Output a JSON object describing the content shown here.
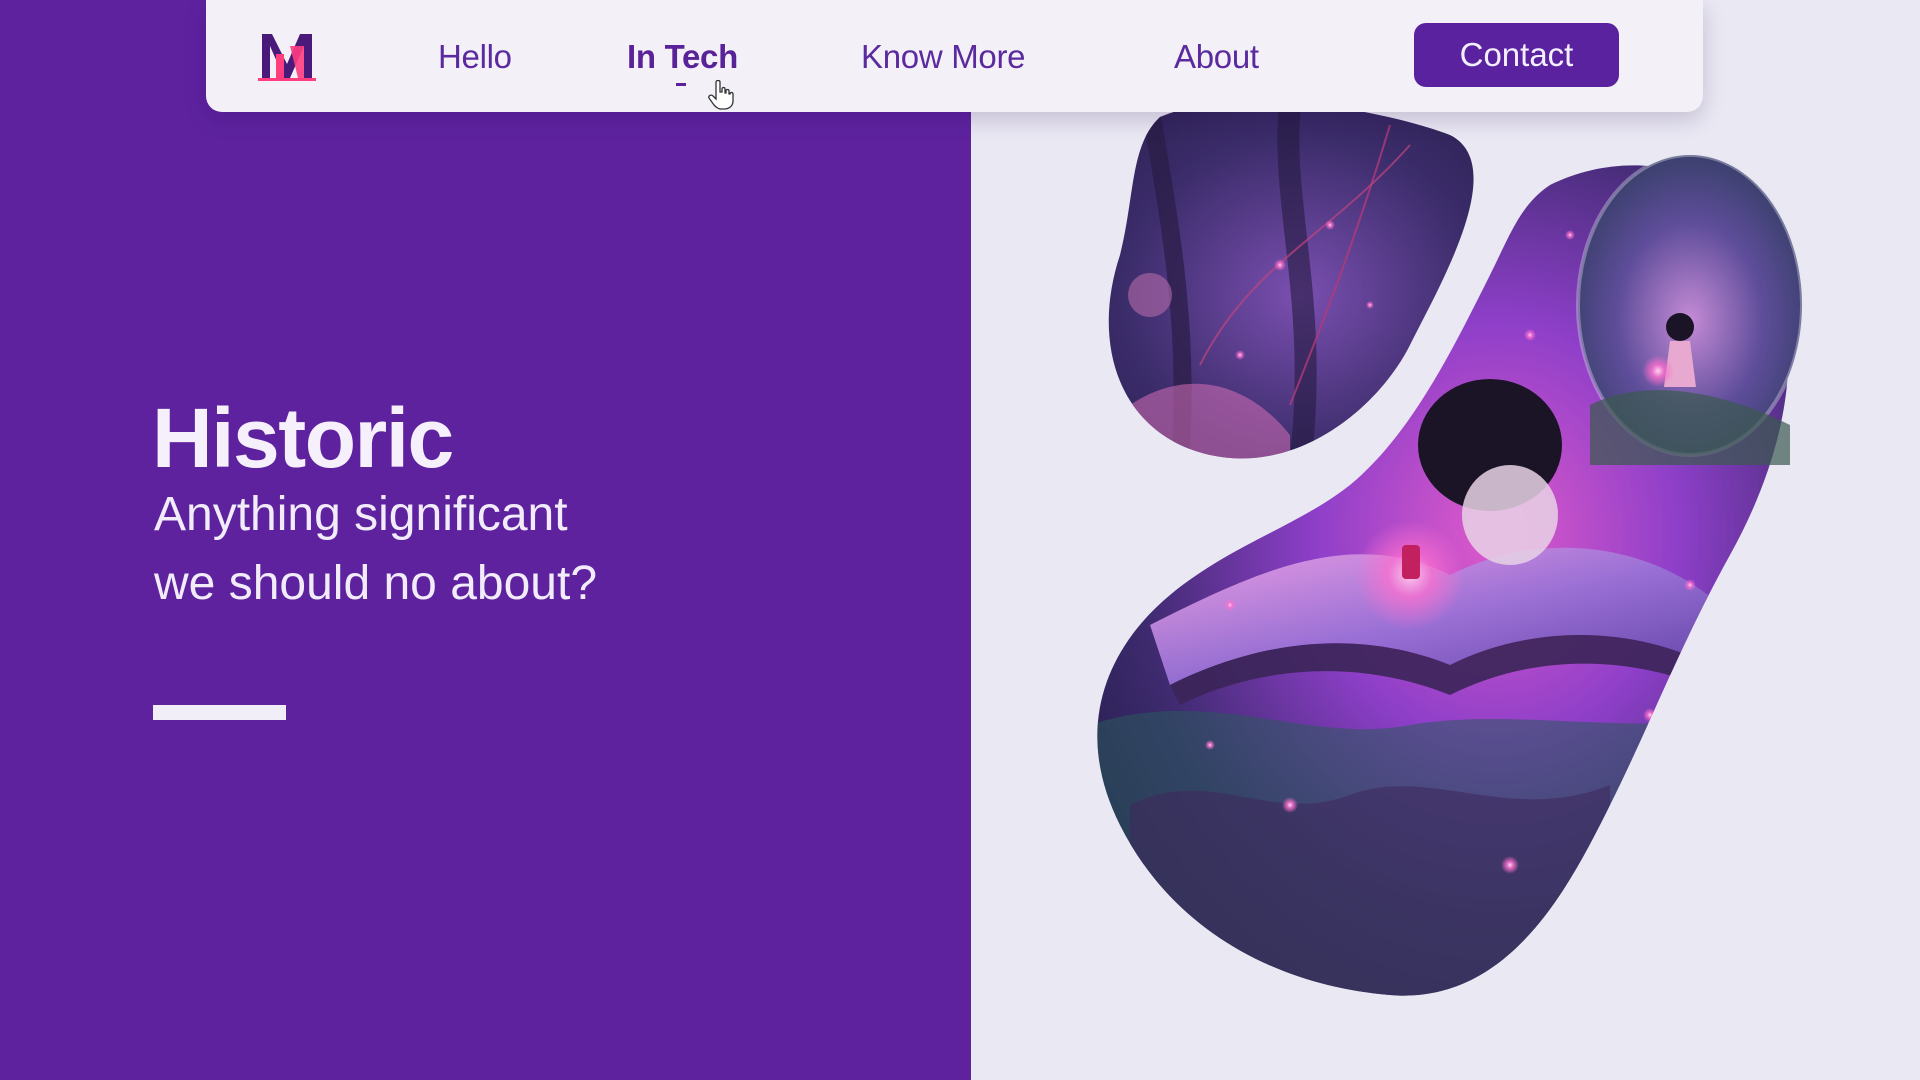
{
  "nav": {
    "logo_alt": "M",
    "items": [
      {
        "label": "Hello",
        "active": false
      },
      {
        "label": "In Tech",
        "active": true
      },
      {
        "label": "Know More",
        "active": false
      },
      {
        "label": "About",
        "active": false
      }
    ],
    "contact_label": "Contact"
  },
  "hero": {
    "title": "Historic",
    "subtitle_line1": "Anything significant",
    "subtitle_line2": "we should no about?"
  },
  "colors": {
    "brand_purple": "#5e229f",
    "background": "#e9e8f3",
    "logo_pink": "#ff3d7f"
  },
  "icons": {
    "logo": "m-logo-icon",
    "cursor": "hand-pointer-icon"
  }
}
